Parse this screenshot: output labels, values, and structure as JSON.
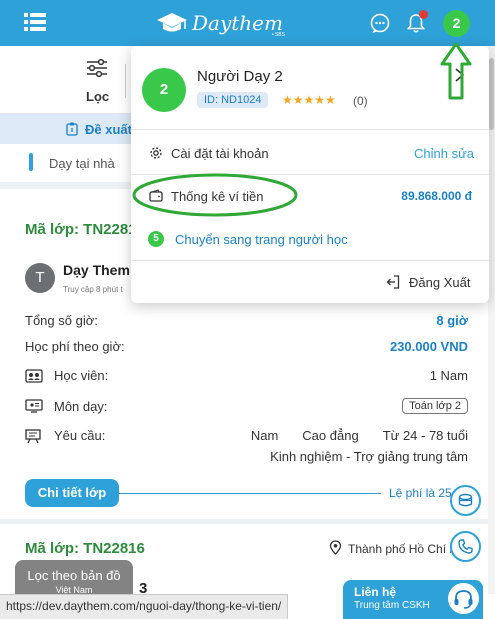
{
  "header": {
    "logo_text": "Daythem",
    "logo_sub": "• SBS",
    "avatar_initial": "2"
  },
  "filter": {
    "label": "Lọc"
  },
  "suggest": {
    "label": "Đề xuất"
  },
  "tab": {
    "label": "Dạy tại nhà"
  },
  "class_card": {
    "code": "Mã lớp: TN2281",
    "tutor_initial": "T",
    "tutor_name": "Dạy Them",
    "tutor_access": "Truy cập 8 phút t",
    "rows": {
      "total_hours_label": "Tổng số giờ:",
      "total_hours_value": "8 giờ",
      "fee_label": "Học phí theo giờ:",
      "fee_value": "230.000 VND",
      "student_label": "Học viên:",
      "student_value": "1 Nam",
      "subject_label": "Môn dạy:",
      "subject_value": "Toán lớp 2",
      "requirement_label": "Yêu cầu:",
      "req_gender": "Nam",
      "req_level": "Cao đẳng",
      "req_age": "Từ 24 - 78 tuổi",
      "req_experience": "Kinh nghiệm - Trợ giảng trung tâm"
    },
    "detail_button": "Chi tiết lớp",
    "fee_text": "Lệ phí là 25"
  },
  "class_card_2": {
    "code": "Mã lớp: TN22816",
    "location": "Thành phố Hồ Chí M",
    "title_fragment": "3"
  },
  "map_filter": {
    "label": "Lọc theo bản đồ",
    "sub": "Việt Nam"
  },
  "support": {
    "title": "Liên hệ",
    "subtitle": "Trung tâm CSKH"
  },
  "status_url": "https://dev.daythem.com/nguoi-day/thong-ke-vi-tien/",
  "dropdown": {
    "avatar_initial": "2",
    "name": "Người Dạy 2",
    "id_badge": "ID: ND1024",
    "stars": "★★★★★",
    "rating_count": "(0)",
    "settings_label": "Cài đặt tài khoản",
    "edit_label": "Chỉnh sửa",
    "wallet_label": "Thống kê ví tiền",
    "wallet_balance": "89.868.000 đ",
    "switch_number": "5",
    "switch_label": "Chuyển sang trang người học",
    "logout_label": "Đăng Xuất"
  },
  "colors": {
    "primary": "#2ea1d8",
    "green": "#3ac84a",
    "code_green": "#2e8b3e",
    "link_blue": "#1c80c6",
    "annotation_green": "#2fa836"
  },
  "icons": [
    "menu-icon",
    "graduation-cap-icon",
    "chat-icon",
    "bell-icon",
    "sliders-icon",
    "clipboard-icon",
    "chevron-right-icon",
    "gear-icon",
    "wallet-icon",
    "logout-icon",
    "user-icon",
    "monitor-icon",
    "presentation-icon",
    "location-pin-icon",
    "box-icon",
    "phone-icon",
    "headset-icon"
  ]
}
